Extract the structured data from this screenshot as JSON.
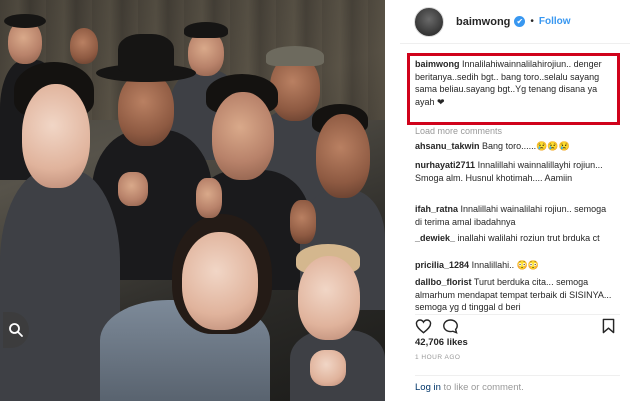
{
  "post": {
    "username": "baimwong",
    "verified_glyph": "✔",
    "dot": "•",
    "follow_label": "Follow",
    "caption_user": "baimwong",
    "caption_text": "Innalilahiwainnalilahirojiun.. denger beritanya..sedih bgt.. bang toro..selalu sayang sama beliau.sayang bgt..Yg tenang disana ya ayah ❤",
    "load_more": "Load more comments",
    "comments": [
      {
        "user": "ahsanu_takwin",
        "text": "Bang toro......😢😢😢"
      },
      {
        "user": "nurhayati2711",
        "text": "Innalillahi wainnalillayhi rojiun... Smoga alm. Husnul khotimah.... Aamiin"
      },
      {
        "user": "ifah_ratna",
        "text": "Innalillahi wainalilahi rojiun.. semoga di terima amal ibadahnya"
      },
      {
        "user": "_dewiek_",
        "text": "inallahi walilahi roziun trut brduka ct"
      },
      {
        "user": "pricilia_1284",
        "text": "Innalillahi.. 😳😳"
      },
      {
        "user": "dallbo_florist",
        "text": "Turut berduka cita... semoga almarhum mendapat tempat terbaik di SISINYA... semoga yg d tinggal d beri"
      }
    ],
    "likes": "42,706 likes",
    "time": "1 HOUR AGO",
    "login_link": "Log in",
    "login_rest": " to like or comment."
  },
  "icons": {
    "zoom": "search-icon",
    "like": "heart-icon",
    "comment": "comment-icon",
    "save": "bookmark-icon",
    "verified": "verified-badge-icon"
  },
  "colors": {
    "highlight_border": "#d0021b",
    "link_blue": "#3897f0",
    "muted": "#999999"
  }
}
